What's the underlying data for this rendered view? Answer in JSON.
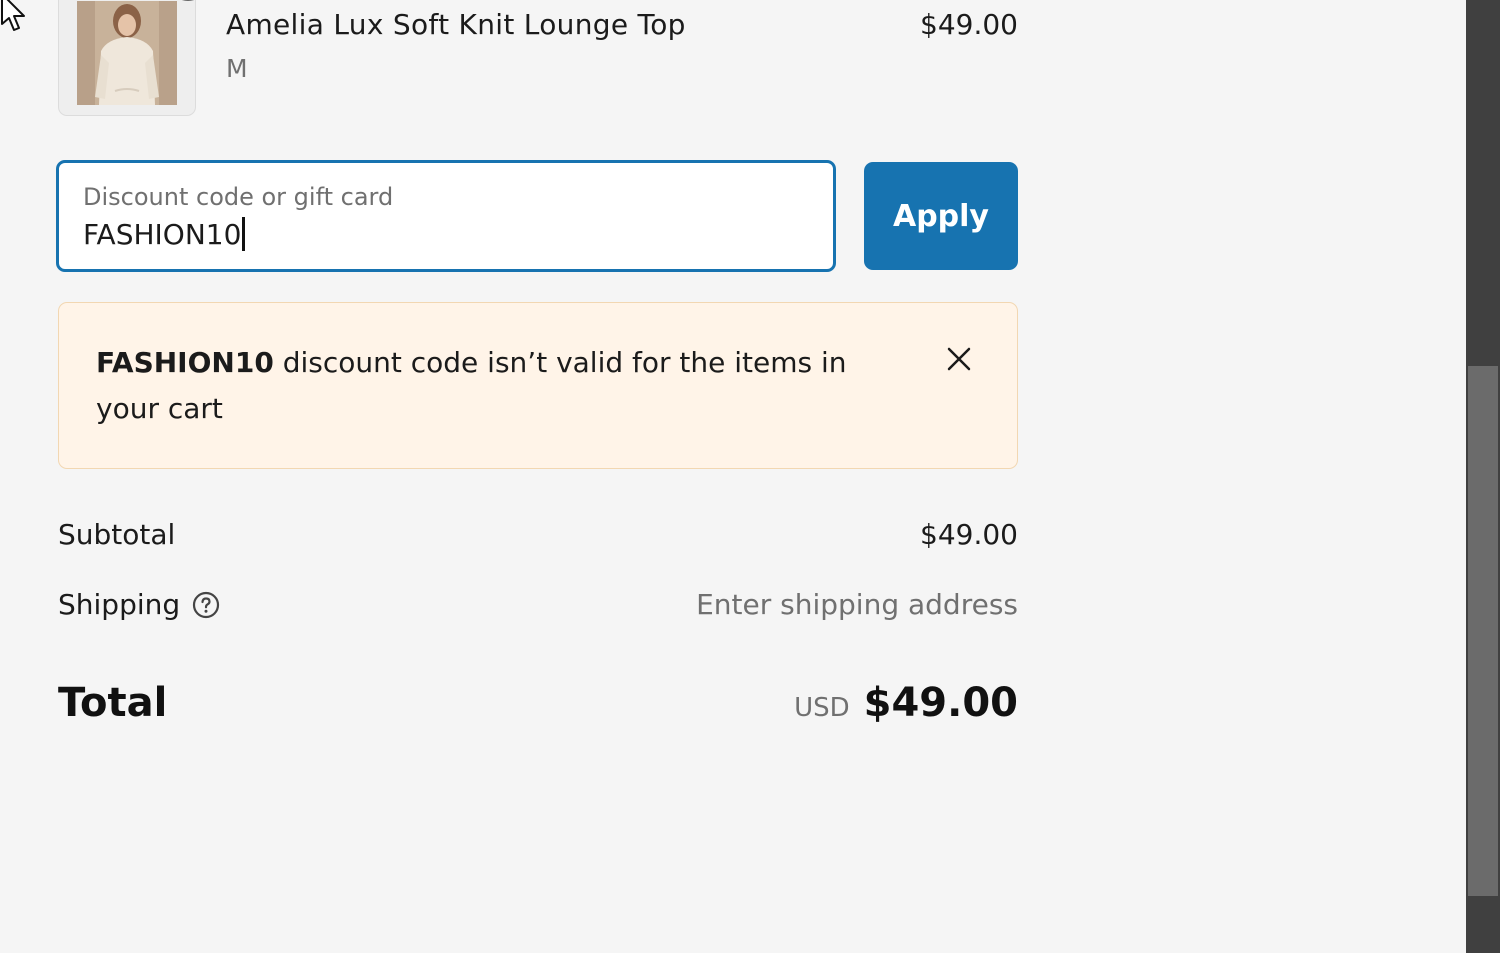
{
  "line_item": {
    "name": "Amelia Lux Soft Knit Lounge Top",
    "variant": "M",
    "price": "$49.00",
    "image": "product-thumbnail"
  },
  "discount": {
    "label": "Discount code or gift card",
    "value": "FASHION10",
    "apply_label": "Apply"
  },
  "warning": {
    "code": "FASHION10",
    "message": " discount code isn’t valid for the items in your cart",
    "close_icon": "close-icon"
  },
  "summary": {
    "subtotal_label": "Subtotal",
    "subtotal_value": "$49.00",
    "shipping_label": "Shipping",
    "shipping_value": "Enter shipping address",
    "shipping_help_icon": "help-circle-icon",
    "total_label": "Total",
    "currency": "USD",
    "total_value": "$49.00"
  },
  "colors": {
    "accent": "#1773b0",
    "warning_bg": "#fff4e8",
    "warning_border": "#f2d7b2",
    "page_bg": "#f5f5f5"
  }
}
